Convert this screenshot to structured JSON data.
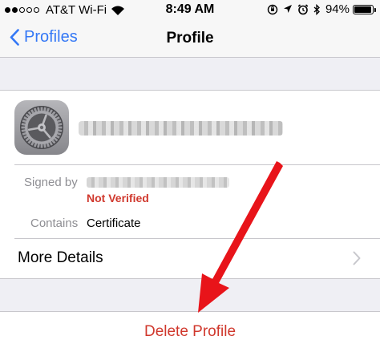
{
  "status_bar": {
    "carrier": "AT&T Wi-Fi",
    "time": "8:49 AM",
    "battery_percent": "94%",
    "battery_level": 0.94,
    "signal_bars_filled": 2,
    "signal_bars_total": 5
  },
  "nav": {
    "back_label": "Profiles",
    "title": "Profile"
  },
  "profile": {
    "icon": "settings-gear-icon",
    "signed_by_label": "Signed by",
    "verification_status": "Not Verified",
    "contains_label": "Contains",
    "contains_value": "Certificate",
    "more_details_label": "More Details"
  },
  "actions": {
    "delete_label": "Delete Profile"
  },
  "colors": {
    "ios_blue": "#3478f6",
    "destructive_red": "#d0382d",
    "arrow_red": "#e8141a",
    "group_background": "#efeff4"
  }
}
